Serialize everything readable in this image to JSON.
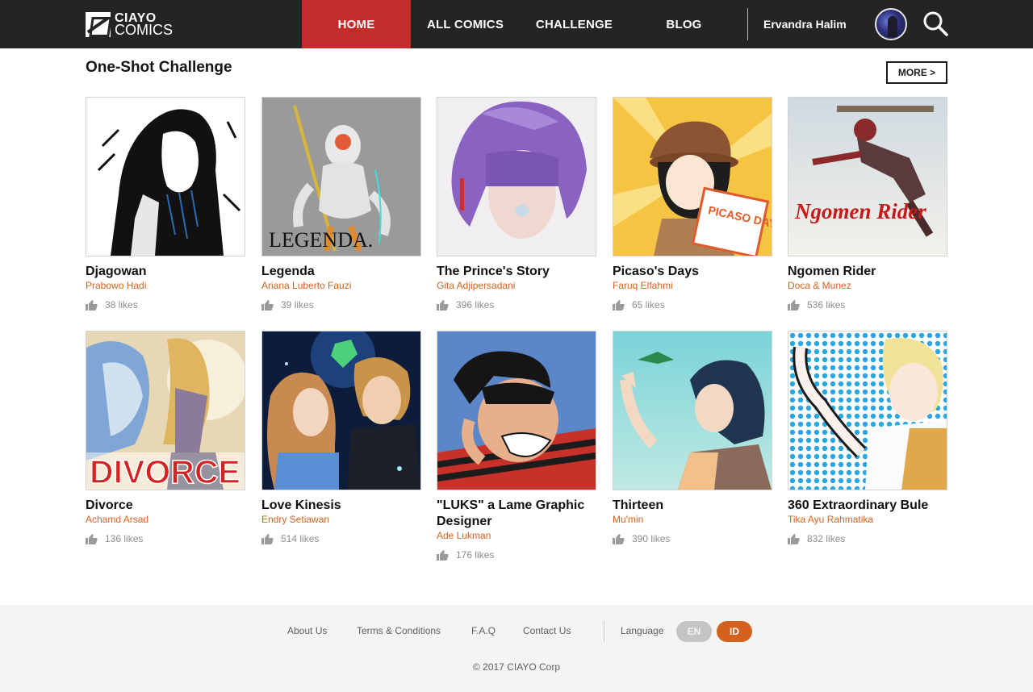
{
  "brand": {
    "line1": "CIAYO",
    "line2": "COMICS"
  },
  "nav": {
    "items": [
      {
        "label": "HOME",
        "active": true
      },
      {
        "label": "ALL COMICS",
        "active": false
      },
      {
        "label": "CHALLENGE",
        "active": false
      },
      {
        "label": "BLOG",
        "active": false
      }
    ],
    "user_name": "Ervandra Halim"
  },
  "section": {
    "title": "One-Shot Challenge",
    "more_label": "MORE >"
  },
  "comics": [
    {
      "title": "Djagowan",
      "author": "Prabowo Hadi",
      "likes": "38 likes",
      "cover": "hooded-figure"
    },
    {
      "title": "Legenda",
      "author": "Ariana Luberto Fauzi",
      "likes": "39 likes",
      "cover": "monkey-king",
      "cover_text": "LEGENDA."
    },
    {
      "title": "The Prince's Story",
      "author": "Gita Adjipersadani",
      "likes": "396 likes",
      "cover": "purple-hair"
    },
    {
      "title": "Picaso's Days",
      "author": "Faruq Elfahmi",
      "likes": "65 likes",
      "cover": "detective-girl",
      "cover_text": "PICASO DAYS"
    },
    {
      "title": "Ngomen Rider",
      "author": "Doca & Munez",
      "likes": "536 likes",
      "cover": "flying-hero",
      "cover_text": "Ngomen Rider"
    },
    {
      "title": "Divorce",
      "author": "Achamd Arsad",
      "likes": "136 likes",
      "cover": "divorce-couple",
      "cover_text": "DIVORCE"
    },
    {
      "title": "Love Kinesis",
      "author": "Endry Setiawan",
      "likes": "514 likes",
      "cover": "couple-gem"
    },
    {
      "title": "\"LUKS\" a Lame Graphic Designer",
      "author": "Ade Lukman",
      "likes": "176 likes",
      "cover": "stressed-man"
    },
    {
      "title": "Thirteen",
      "author": "Mu'min",
      "likes": "390 likes",
      "cover": "girl-bird"
    },
    {
      "title": "360 Extraordinary Bule",
      "author": "Tika Ayu Rahmatika",
      "likes": "832 likes",
      "cover": "blond-boy"
    }
  ],
  "footer": {
    "links": [
      "About Us",
      "Terms & Conditions",
      "F.A.Q",
      "Contact Us"
    ],
    "language_label": "Language",
    "languages": [
      {
        "code": "EN",
        "active": false
      },
      {
        "code": "ID",
        "active": true
      }
    ],
    "copyright": "© 2017 CIAYO Corp"
  },
  "colors": {
    "nav_bg": "#242424",
    "accent_red": "#c42c2b",
    "author_orange": "#d4621f",
    "footer_bg": "#f4f4f4"
  },
  "icons": [
    "logo-icon",
    "search-icon",
    "thumbs-up-icon",
    "avatar"
  ]
}
